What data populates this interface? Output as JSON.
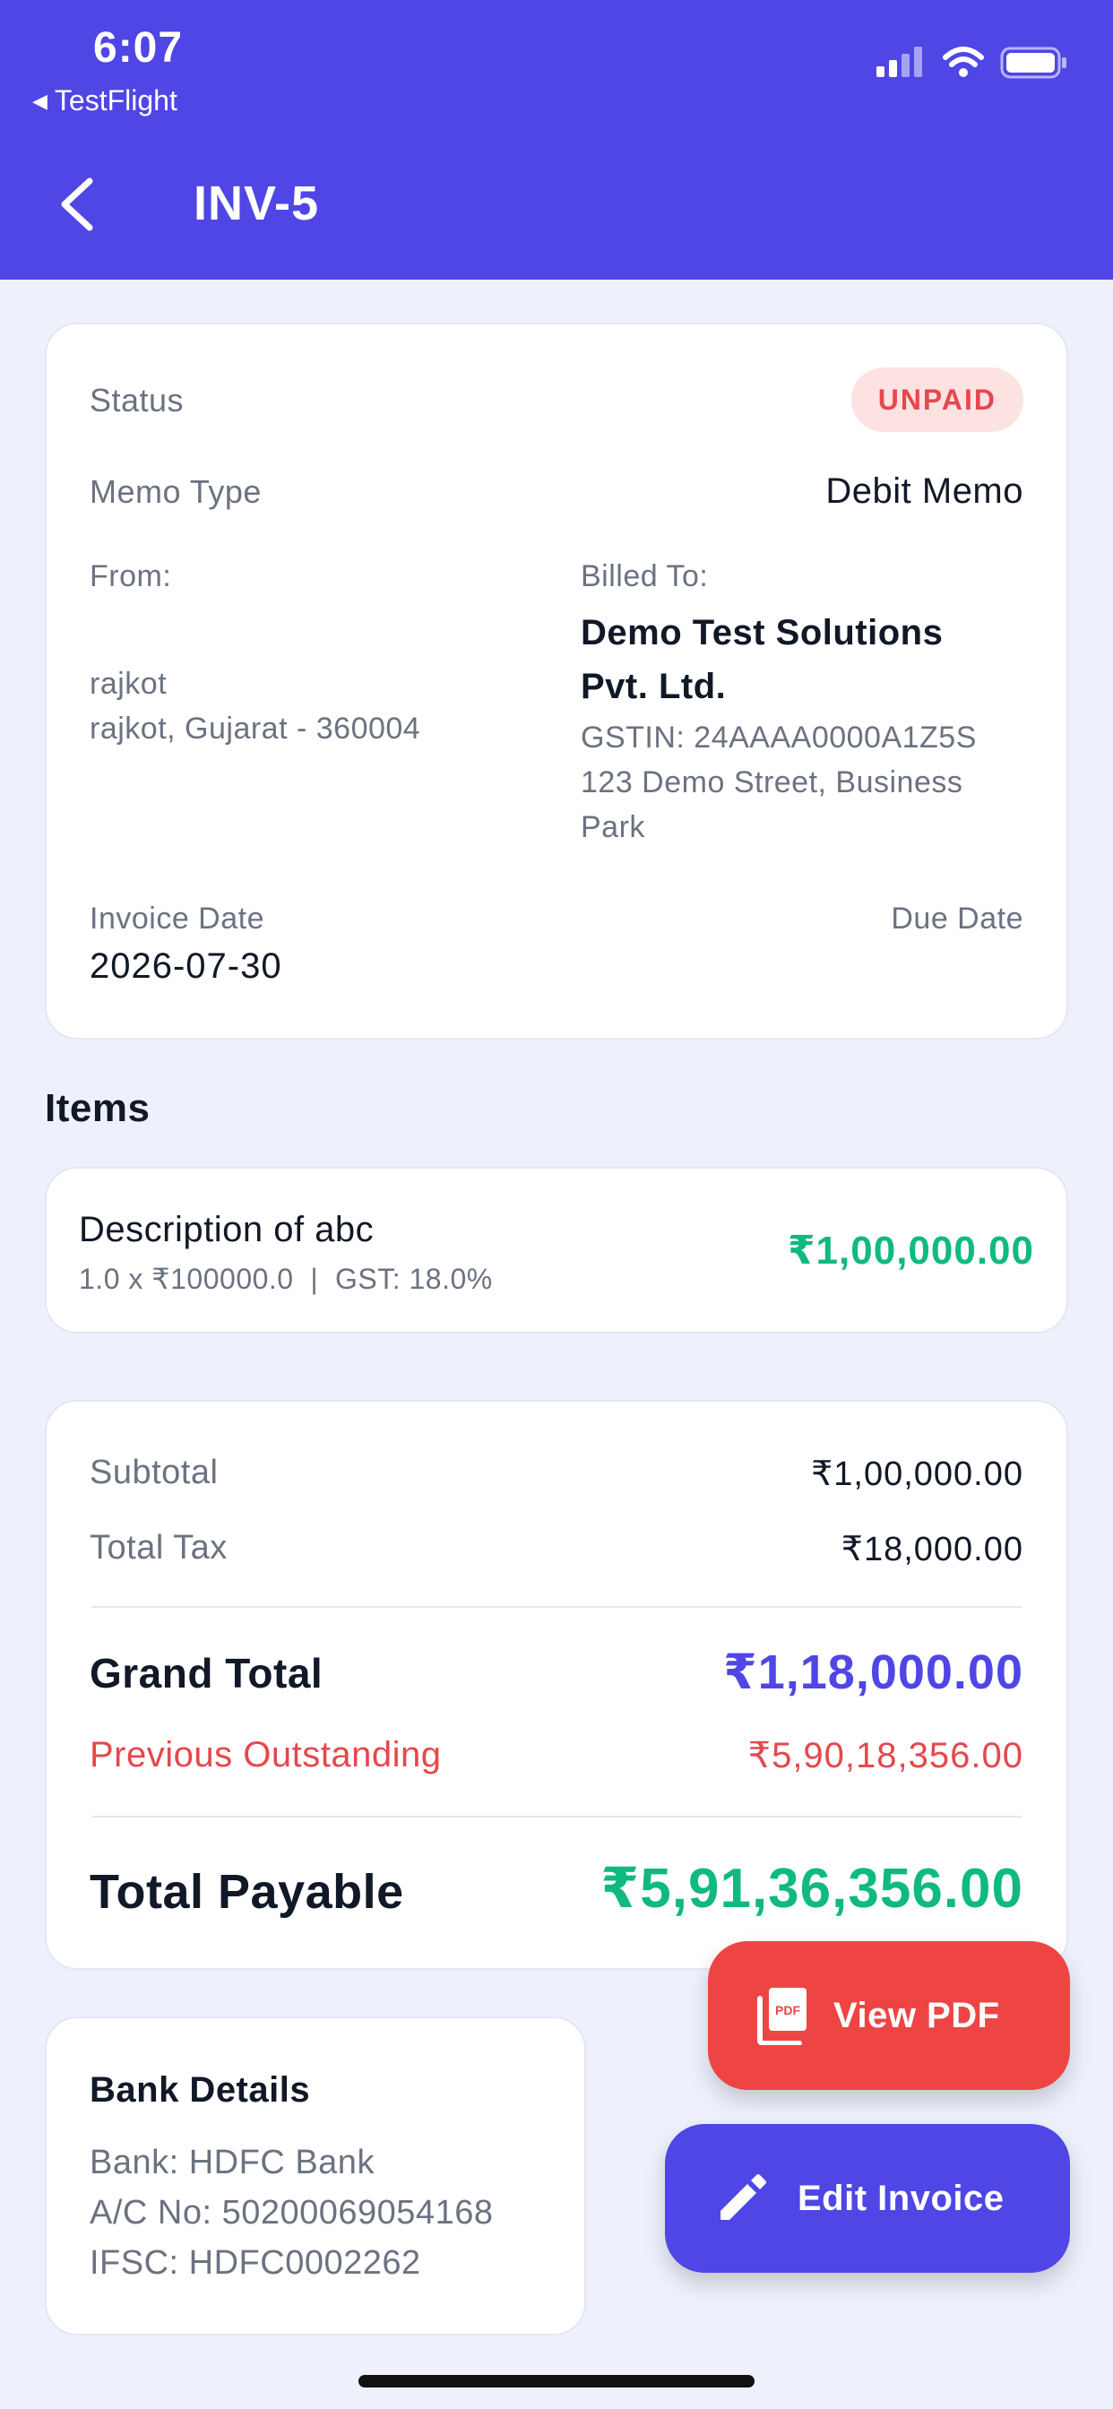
{
  "status_bar": {
    "time": "6:07",
    "back_app": "TestFlight"
  },
  "nav": {
    "title": "INV-5"
  },
  "invoice": {
    "status_label": "Status",
    "status_value": "UNPAID",
    "memo_type_label": "Memo Type",
    "memo_type_value": "Debit Memo",
    "from_label": "From:",
    "from_line1": "rajkot",
    "from_line2": "rajkot, Gujarat - 360004",
    "billed_to_label": "Billed To:",
    "billed_to_name_line1": "Demo Test Solutions",
    "billed_to_name_line2": "Pvt. Ltd.",
    "billed_gstin": "GSTIN: 24AAAA0000A1Z5S",
    "billed_address_line1": "123 Demo Street, Business",
    "billed_address_line2": "Park",
    "invoice_date_label": "Invoice Date",
    "invoice_date_value": "2026-07-30",
    "due_date_label": "Due Date"
  },
  "items": {
    "heading": "Items",
    "list": [
      {
        "title": "Description of abc",
        "meta": "1.0 x ₹100000.0  |  GST: 18.0%",
        "amount": "₹1,00,000.00"
      }
    ]
  },
  "totals": {
    "subtotal_label": "Subtotal",
    "subtotal_value": "₹1,00,000.00",
    "tax_label": "Total Tax",
    "tax_value": "₹18,000.00",
    "grand_total_label": "Grand Total",
    "grand_total_value": "₹1,18,000.00",
    "prev_outstanding_label": "Previous Outstanding",
    "prev_outstanding_value": "₹5,90,18,356.00",
    "total_payable_label": "Total Payable",
    "total_payable_value": "₹5,91,36,356.00"
  },
  "bank": {
    "heading": "Bank Details",
    "bank": "Bank: HDFC Bank",
    "account": "A/C No: 50200069054168",
    "ifsc": "IFSC: HDFC0002262"
  },
  "actions": {
    "view_pdf_label": "View PDF",
    "edit_invoice_label": "Edit Invoice"
  },
  "colors": {
    "header": "#4F46E5",
    "unpaid": "#E5484D",
    "green": "#10B981",
    "indigo": "#4F46E5",
    "red_button": "#EF4444"
  },
  "icons": [
    "chevron-left-icon",
    "signal-icon",
    "wifi-icon",
    "battery-icon",
    "pdf-icon",
    "pencil-icon"
  ]
}
